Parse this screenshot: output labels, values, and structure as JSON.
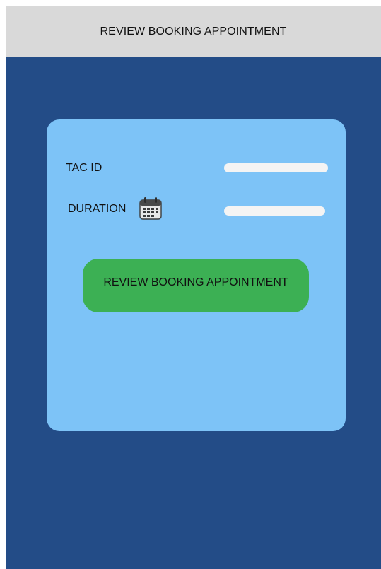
{
  "header": {
    "title": "REVIEW BOOKING APPOINTMENT"
  },
  "form": {
    "tac_id_label": "TAC ID",
    "tac_id_value": "",
    "duration_label": "DURATION",
    "duration_value": "",
    "duration_icon": "calendar-icon",
    "submit_label": "REVIEW BOOKING APPOINTMENT"
  },
  "colors": {
    "header_bg": "#d9d9d9",
    "screen_bg": "#234c87",
    "card_bg": "#7dc3f7",
    "button_bg": "#3cb054",
    "field_bg": "#f4f4f4"
  }
}
